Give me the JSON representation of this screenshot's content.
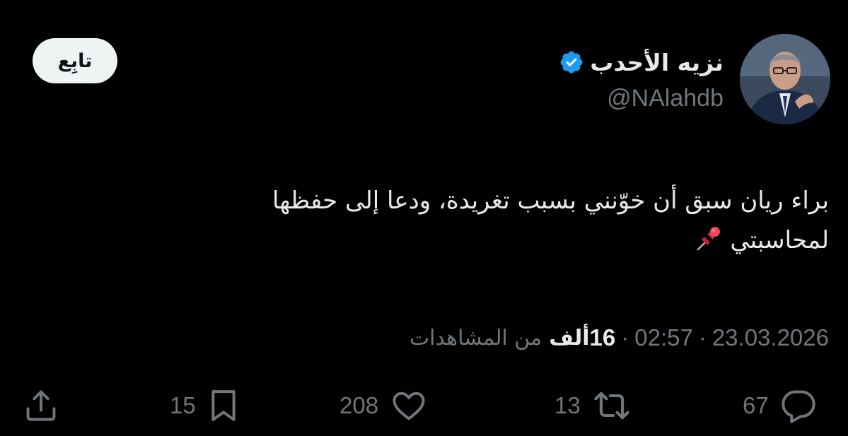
{
  "user": {
    "display_name": "نزيه الأحدب",
    "handle": "@NAlahdb",
    "verified_icon": "verified-badge-icon",
    "avatar": "avatar-photo",
    "verified_color": "#1d9bf0"
  },
  "follow_button": {
    "label": "تابِع"
  },
  "tweet": {
    "line1": "براء ريان سبق أن خوّنني بسبب تغريدة، ودعا إلى حفظها",
    "line2": "لمحاسبتي",
    "emoji_icon": "pushpin-icon"
  },
  "meta": {
    "date": "23.03.2026",
    "separator": "·",
    "time": "02:57",
    "views_count": "16",
    "views_unit": "ألف",
    "views_label": "من المشاهدات"
  },
  "actions": {
    "replies": {
      "icon": "reply-icon",
      "count": "67"
    },
    "retweets": {
      "icon": "retweet-icon",
      "count": "13"
    },
    "likes": {
      "icon": "heart-icon",
      "count": "208"
    },
    "bookmarks": {
      "icon": "bookmark-icon",
      "count": "15"
    },
    "share": {
      "icon": "share-icon"
    }
  },
  "colors": {
    "background": "#000000",
    "text_primary": "#e7e9ea",
    "text_secondary": "#71767b",
    "button_bg": "#eff3f4"
  }
}
